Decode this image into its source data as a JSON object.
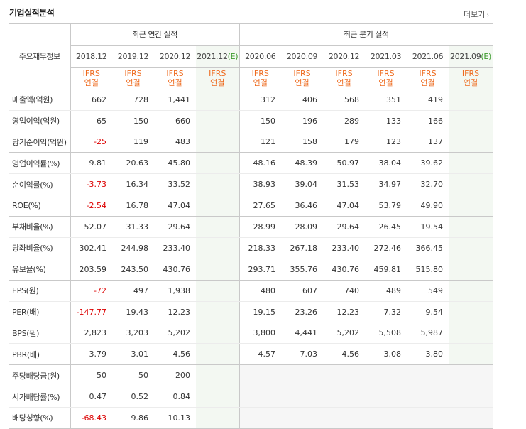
{
  "section": {
    "title": "기업실적분석",
    "more": "더보기"
  },
  "table": {
    "row_header": "주요재무정보",
    "annual_title": "최근 연간 실적",
    "quarterly_title": "최근 분기 실적",
    "periods": [
      {
        "label": "2018.12",
        "est": false
      },
      {
        "label": "2019.12",
        "est": false
      },
      {
        "label": "2020.12",
        "est": false
      },
      {
        "label": "2021.12",
        "est": true
      },
      {
        "label": "2020.06",
        "est": false
      },
      {
        "label": "2020.09",
        "est": false
      },
      {
        "label": "2020.12",
        "est": false
      },
      {
        "label": "2021.03",
        "est": false
      },
      {
        "label": "2021.06",
        "est": false
      },
      {
        "label": "2021.09",
        "est": true
      }
    ],
    "est_mark": "(E)",
    "ifrs_top": "IFRS",
    "ifrs_bottom": "연결",
    "rows": [
      {
        "label": "매출액(억원)",
        "values": [
          "662",
          "728",
          "1,441",
          "",
          "312",
          "406",
          "568",
          "351",
          "419",
          ""
        ]
      },
      {
        "label": "영업이익(억원)",
        "values": [
          "65",
          "150",
          "660",
          "",
          "150",
          "196",
          "289",
          "133",
          "166",
          ""
        ]
      },
      {
        "label": "당기순이익(억원)",
        "values": [
          "-25",
          "119",
          "483",
          "",
          "121",
          "158",
          "179",
          "123",
          "137",
          ""
        ],
        "group_end": true
      },
      {
        "label": "영업이익률(%)",
        "values": [
          "9.81",
          "20.63",
          "45.80",
          "",
          "48.16",
          "48.39",
          "50.97",
          "38.04",
          "39.62",
          ""
        ]
      },
      {
        "label": "순이익률(%)",
        "values": [
          "-3.73",
          "16.34",
          "33.52",
          "",
          "38.93",
          "39.04",
          "31.53",
          "34.97",
          "32.70",
          ""
        ]
      },
      {
        "label": "ROE(%)",
        "values": [
          "-2.54",
          "16.78",
          "47.04",
          "",
          "27.65",
          "36.46",
          "47.04",
          "53.79",
          "49.90",
          ""
        ],
        "group_end": true
      },
      {
        "label": "부채비율(%)",
        "values": [
          "52.07",
          "31.33",
          "29.64",
          "",
          "28.99",
          "28.09",
          "29.64",
          "26.45",
          "19.54",
          ""
        ]
      },
      {
        "label": "당좌비율(%)",
        "values": [
          "302.41",
          "244.98",
          "233.40",
          "",
          "218.33",
          "267.18",
          "233.40",
          "272.46",
          "366.45",
          ""
        ]
      },
      {
        "label": "유보율(%)",
        "values": [
          "203.59",
          "243.50",
          "430.76",
          "",
          "293.71",
          "355.76",
          "430.76",
          "459.81",
          "515.80",
          ""
        ],
        "group_end": true
      },
      {
        "label": "EPS(원)",
        "values": [
          "-72",
          "497",
          "1,938",
          "",
          "480",
          "607",
          "740",
          "489",
          "549",
          ""
        ]
      },
      {
        "label": "PER(배)",
        "values": [
          "-147.77",
          "19.43",
          "12.23",
          "",
          "19.15",
          "23.26",
          "12.23",
          "7.32",
          "9.54",
          ""
        ]
      },
      {
        "label": "BPS(원)",
        "values": [
          "2,823",
          "3,203",
          "5,202",
          "",
          "3,800",
          "4,441",
          "5,202",
          "5,508",
          "5,987",
          ""
        ]
      },
      {
        "label": "PBR(배)",
        "values": [
          "3.79",
          "3.01",
          "4.56",
          "",
          "4.57",
          "7.03",
          "4.56",
          "3.08",
          "3.80",
          ""
        ],
        "group_end": true
      },
      {
        "label": "주당배당금(원)",
        "values": [
          "50",
          "50",
          "200",
          "",
          "",
          "",
          "",
          "",
          "",
          ""
        ],
        "no_quarterly": true
      },
      {
        "label": "시가배당률(%)",
        "values": [
          "0.47",
          "0.52",
          "0.84",
          "",
          "",
          "",
          "",
          "",
          "",
          ""
        ],
        "no_quarterly": true
      },
      {
        "label": "배당성향(%)",
        "values": [
          "-68.43",
          "9.86",
          "10.13",
          "",
          "",
          "",
          "",
          "",
          "",
          ""
        ],
        "no_quarterly": true
      }
    ]
  },
  "colors": {
    "ifrs": "#ee6b1f",
    "estimate": "#3b9a2c",
    "negative": "#dc0000",
    "estimate_bg": "#f3f8f2"
  }
}
